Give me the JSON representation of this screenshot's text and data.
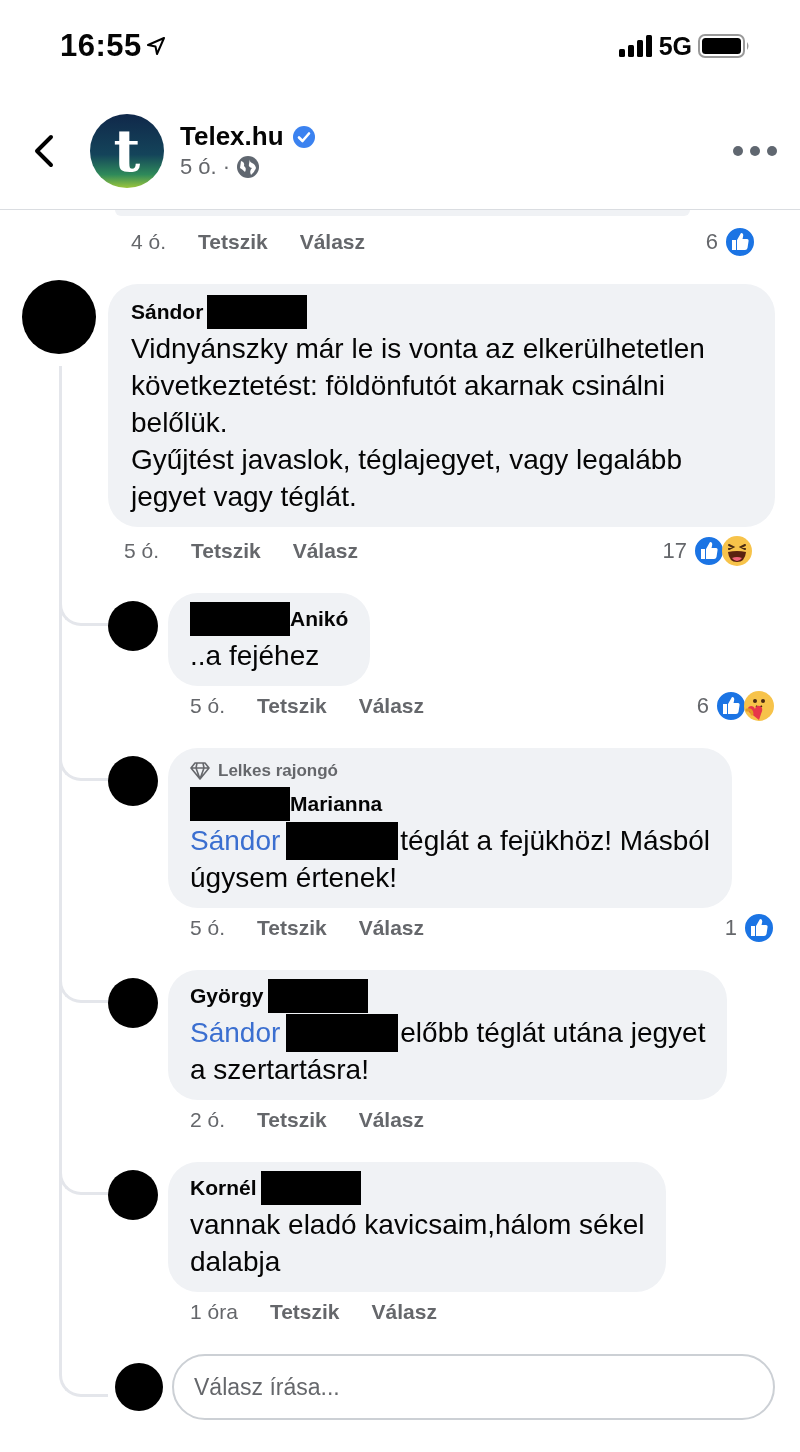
{
  "status_bar": {
    "time": "16:55",
    "network": "5G"
  },
  "header": {
    "logo_letter": "t",
    "title": "Telex.hu",
    "verified": true,
    "meta": "5 ó. ·"
  },
  "previous_comment": {
    "time": "4 ó.",
    "like": "Tetszik",
    "reply": "Válasz",
    "reaction_count": "6",
    "reactions": [
      {
        "kind": "like"
      }
    ]
  },
  "comment": {
    "author_parts": [
      {
        "kind": "name",
        "text": "Sándor"
      },
      {
        "kind": "redacted"
      }
    ],
    "lines": [
      "Vidnyánszky már le is vonta az elkerülhetetlen",
      "következtetést: földönfutót akarnak csinálni",
      "belőlük.",
      "Gyűjtést javaslok, téglajegyet, vagy legalább",
      "jegyet vagy téglát."
    ],
    "time": "5 ó.",
    "like": "Tetszik",
    "reply": "Válasz",
    "reaction_count": "17",
    "reactions": [
      {
        "kind": "like"
      },
      {
        "kind": "haha"
      }
    ]
  },
  "replies": [
    {
      "author_parts": [
        {
          "kind": "redacted"
        },
        {
          "kind": "name",
          "text": "Anikó"
        }
      ],
      "lines": [
        "..a fejéhez"
      ],
      "time": "5 ó.",
      "like": "Tetszik",
      "reply": "Válasz",
      "reaction_count": "6",
      "reactions": [
        {
          "kind": "like"
        },
        {
          "kind": "care"
        }
      ]
    },
    {
      "badge": "Lelkes rajongó",
      "author_parts": [
        {
          "kind": "redacted"
        },
        {
          "kind": "name",
          "text": "Marianna"
        }
      ],
      "mention": "Sándor",
      "lines": [
        "téglát a fejükhöz! Másból",
        "úgysem értenek!"
      ],
      "time": "5 ó.",
      "like": "Tetszik",
      "reply": "Válasz",
      "reaction_count": "1",
      "reactions": [
        {
          "kind": "like"
        }
      ]
    },
    {
      "author_parts": [
        {
          "kind": "name",
          "text": "György"
        },
        {
          "kind": "redacted"
        }
      ],
      "mention": "Sándor",
      "lines": [
        "előbb téglát utána jegyet",
        "a szertartásra!"
      ],
      "time": "2 ó.",
      "like": "Tetszik",
      "reply": "Válasz"
    },
    {
      "author_parts": [
        {
          "kind": "name",
          "text": "Kornél"
        },
        {
          "kind": "redacted"
        }
      ],
      "lines": [
        "vannak eladó kavicsaim,hálom sékel",
        "dalabja"
      ],
      "time": "1 óra",
      "like": "Tetszik",
      "reply": "Válasz"
    }
  ],
  "reply_field": {
    "placeholder": "Válasz írása..."
  }
}
